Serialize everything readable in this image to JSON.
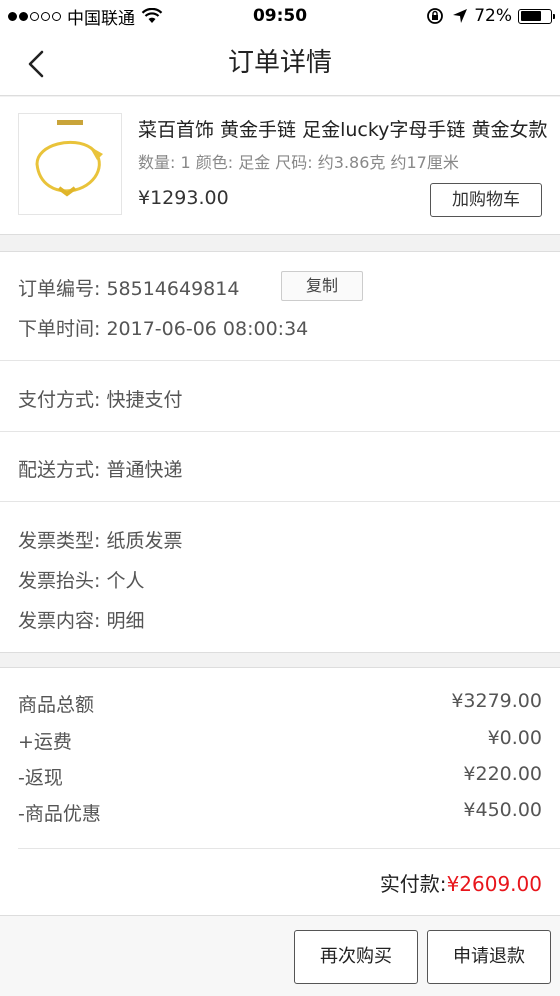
{
  "status_bar": {
    "carrier": "中国联通",
    "time": "09:50",
    "battery": "72%",
    "battery_level": 0.72
  },
  "nav": {
    "title": "订单详情",
    "back_icon": "chevron-left-icon"
  },
  "product": {
    "name": "菜百首饰 黄金手链 足金lucky字母手链 黄金女款",
    "spec": "数量: 1 颜色: 足金 尺码: 约3.86克 约17厘米",
    "price": "¥1293.00",
    "add_to_cart": "加购物车"
  },
  "order": {
    "number_label": "订单编号:",
    "number": "58514649814",
    "copy": "复制",
    "time_label": "下单时间:",
    "time": "2017-06-06 08:00:34",
    "payment_label": "支付方式:",
    "payment": "快捷支付",
    "delivery_label": "配送方式:",
    "delivery": "普通快递",
    "invoice_type_label": "发票类型:",
    "invoice_type": "纸质发票",
    "invoice_title_label": "发票抬头:",
    "invoice_title": "个人",
    "invoice_content_label": "发票内容:",
    "invoice_content": "明细"
  },
  "amounts": {
    "items": [
      {
        "label": "商品总额",
        "value": "¥3279.00"
      },
      {
        "label": "+运费",
        "value": "¥0.00"
      },
      {
        "label": "-返现",
        "value": "¥220.00"
      },
      {
        "label": "-商品优惠",
        "value": "¥450.00"
      }
    ],
    "total_label": "实付款:",
    "total_value": "¥2609.00"
  },
  "actions": {
    "rebuy": "再次购买",
    "refund": "申请退款"
  },
  "colors": {
    "accent_red": "#e8151b",
    "gold": "#e9c33a"
  }
}
